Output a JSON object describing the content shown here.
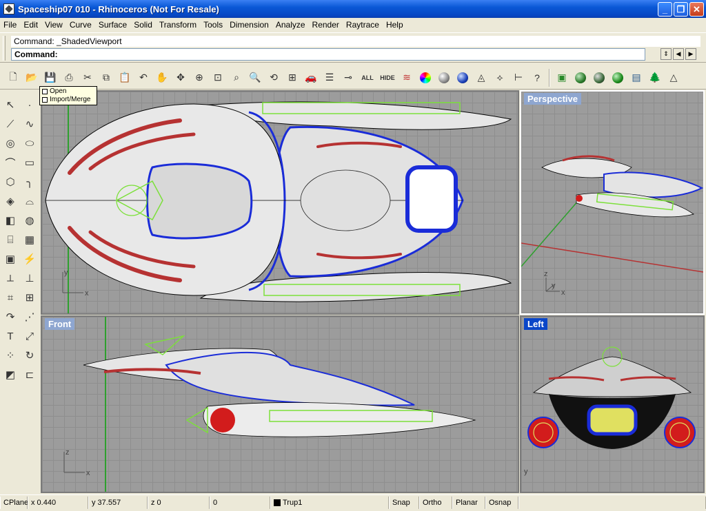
{
  "window": {
    "title": "Spaceship07 010 - Rhinoceros (Not For Resale)",
    "minimize": "_",
    "maximize": "❐",
    "close": "✕"
  },
  "menu": [
    "File",
    "Edit",
    "View",
    "Curve",
    "Surface",
    "Solid",
    "Transform",
    "Tools",
    "Dimension",
    "Analyze",
    "Render",
    "Raytrace",
    "Help"
  ],
  "command": {
    "history": "Command: _ShadedViewport",
    "prompt_label": "Command:",
    "input_value": ""
  },
  "toolbar": {
    "all_label": "ALL",
    "hide_label": "HIDE"
  },
  "tooltip": {
    "line1": "Open",
    "line2": "Import/Merge"
  },
  "viewports": {
    "top": {
      "label": ""
    },
    "perspective": {
      "label": "Perspective"
    },
    "front": {
      "label": "Front"
    },
    "left": {
      "label": "Left"
    }
  },
  "axes": {
    "x": "x",
    "y": "y",
    "z": "z"
  },
  "status": {
    "cplane": "CPlane",
    "x": "x 0.440",
    "y": "y 37.557",
    "z": "z 0",
    "extra": "0",
    "layer": "Trup1",
    "snap": "Snap",
    "ortho": "Ortho",
    "planar": "Planar",
    "osnap": "Osnap"
  },
  "colors": {
    "viewport_bg": "#9c9c9c",
    "active_label": "#0a46c8",
    "inactive_label": "#8ea6d0",
    "hull_outline_blue": "#1a2cd8",
    "accent_red": "#b63232",
    "curve_green": "#7ce03a"
  }
}
